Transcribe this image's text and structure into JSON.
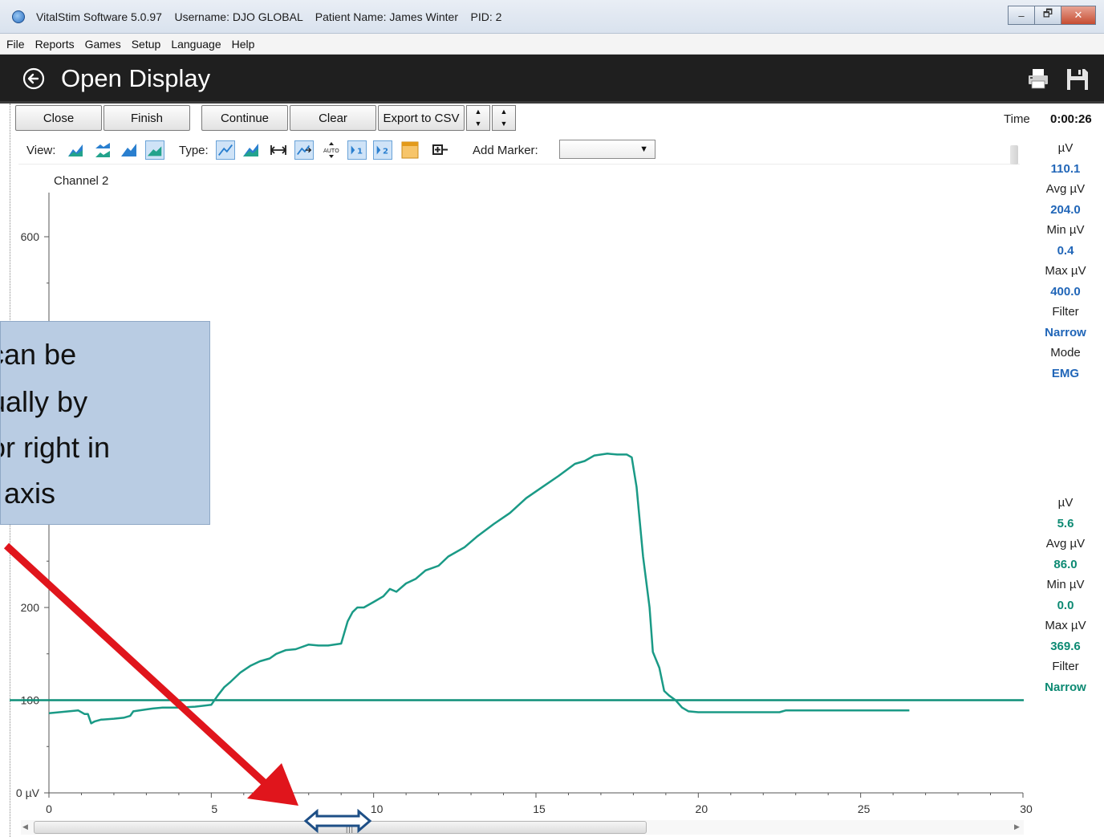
{
  "window": {
    "title": "VitalStim Software 5.0.97    Username: DJO GLOBAL    Patient Name: James Winter    PID: 2",
    "buttons": [
      "–",
      "🗗",
      "✕"
    ]
  },
  "menu": [
    "File",
    "Reports",
    "Games",
    "Setup",
    "Language",
    "Help"
  ],
  "header": {
    "title": "Open Display"
  },
  "toolbar": {
    "close": "Close",
    "finish": "Finish",
    "continue": "Continue",
    "clear": "Clear",
    "export": "Export to CSV"
  },
  "time": {
    "label": "Time",
    "value": "0:00:26"
  },
  "viewbar": {
    "view_label": "View:",
    "type_label": "Type:",
    "marker_label": "Add Marker:",
    "marker_value": "",
    "channel1_label": "1",
    "channel2_label": "2"
  },
  "channel_label": "Channel 2",
  "stats_ch1": {
    "uv_label": "µV",
    "uv": "110.1",
    "avg_label": "Avg µV",
    "avg": "204.0",
    "min_label": "Min µV",
    "min": "0.4",
    "max_label": "Max µV",
    "max": "400.0",
    "filter_label": "Filter",
    "filter": "Narrow",
    "mode_label": "Mode",
    "mode": "EMG"
  },
  "stats_ch2": {
    "uv_label": "µV",
    "uv": "5.6",
    "avg_label": "Avg µV",
    "avg": "86.0",
    "min_label": "Min µV",
    "min": "0.0",
    "max_label": "Max µV",
    "max": "369.6",
    "filter_label": "Filter",
    "filter": "Narrow"
  },
  "callout": {
    "lines": [
      "can be",
      "ually by",
      "or right in",
      "l axis"
    ]
  },
  "colors": {
    "signal": "#1a9a86",
    "threshold": "#0f8f78",
    "arrow": "#e0151c",
    "double_arrow": "#1e4f86"
  },
  "chart_data": {
    "type": "line",
    "xlim": [
      0,
      30
    ],
    "ylim": [
      0,
      650
    ],
    "x_ticks": [
      0,
      5,
      10,
      15,
      20,
      25,
      30
    ],
    "x_tick_labels": [
      "0",
      "5",
      "10",
      "15",
      "20",
      "25",
      "30"
    ],
    "y_tick_labels": [
      {
        "value": 0,
        "label": "0 µV"
      },
      {
        "value": 100,
        "label": "100"
      },
      {
        "value": 200,
        "label": "200"
      },
      {
        "value": 600,
        "label": "600"
      }
    ],
    "threshold": 100,
    "series": [
      {
        "x": [
          0,
          0.9,
          1.1,
          1.2,
          1.3,
          1.4,
          1.6,
          2.0,
          2.3,
          2.5,
          2.6,
          3.0,
          3.2,
          3.5,
          4.0,
          4.5,
          5.0,
          5.2,
          5.4,
          5.6,
          5.9,
          6.2,
          6.5,
          6.8,
          7.0,
          7.3,
          7.6,
          8.0,
          8.3,
          8.6,
          9.0,
          9.2,
          9.35,
          9.5,
          9.7,
          10.0,
          10.3,
          10.5,
          10.7,
          11.0,
          11.3,
          11.6,
          12.0,
          12.3,
          12.8,
          13.2,
          13.7,
          14.2,
          14.7,
          15.2,
          15.7,
          16.2,
          16.5,
          16.8,
          17.2,
          17.5,
          17.8,
          17.95,
          18.1,
          18.3,
          18.5,
          18.6,
          18.8,
          18.95,
          19.1,
          19.3,
          19.5,
          19.7,
          20.0,
          20.5,
          21.0,
          21.5,
          22.0,
          22.5,
          22.7,
          23.0,
          24.0,
          25.0,
          26.0,
          26.5
        ],
        "y": [
          86,
          89,
          85,
          85,
          75,
          77,
          79,
          80,
          81,
          83,
          88,
          90,
          91,
          92,
          92,
          93,
          95,
          105,
          114,
          120,
          130,
          137,
          142,
          145,
          150,
          154,
          155,
          160,
          159,
          159,
          161,
          185,
          195,
          200,
          200,
          206,
          212,
          220,
          217,
          226,
          231,
          240,
          245,
          255,
          265,
          277,
          290,
          302,
          318,
          330,
          342,
          355,
          358,
          364,
          366,
          365,
          365,
          362,
          330,
          255,
          200,
          152,
          135,
          110,
          105,
          100,
          92,
          88,
          87,
          87,
          87,
          87,
          87,
          87,
          89,
          89,
          89,
          89,
          89,
          89
        ]
      }
    ]
  }
}
